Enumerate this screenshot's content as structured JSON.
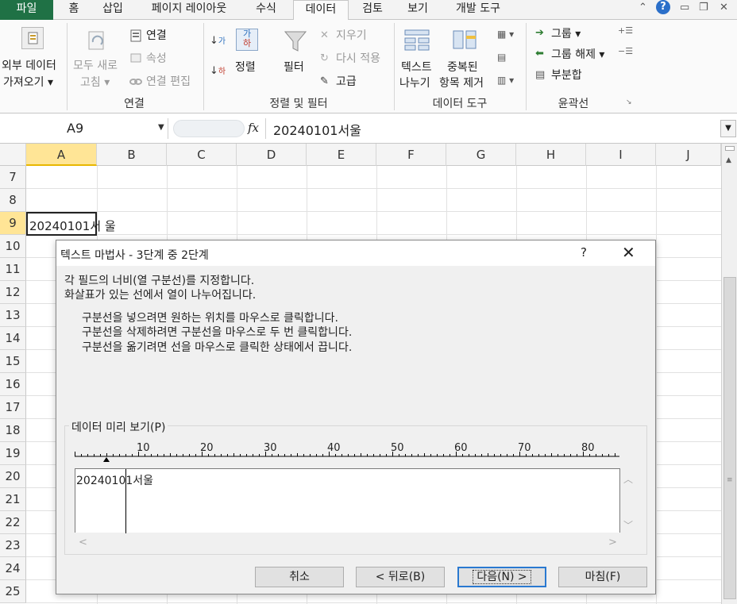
{
  "tabs": [
    {
      "id": "file",
      "label": "파일"
    },
    {
      "id": "home",
      "label": "홈"
    },
    {
      "id": "insert",
      "label": "삽입"
    },
    {
      "id": "page-layout",
      "label": "페이지 레이아웃"
    },
    {
      "id": "formulas",
      "label": "수식"
    },
    {
      "id": "data",
      "label": "데이터"
    },
    {
      "id": "review",
      "label": "검토"
    },
    {
      "id": "view",
      "label": "보기"
    },
    {
      "id": "developer",
      "label": "개발 도구"
    }
  ],
  "window_controls": {
    "minimize_ribbon": "⌃",
    "help": "?",
    "minimize": "▭",
    "restore": "❐",
    "close": "✕"
  },
  "ribbon": {
    "external_data_line1": "외부 데이터",
    "external_data_line2": "가져오기 ▾",
    "refresh_all_line1": "모두 새로",
    "refresh_all_line2": "고침 ▾",
    "connections": "연결",
    "properties": "속성",
    "edit_links": "연결 편집",
    "group_connections": "연결",
    "sort": "정렬",
    "filter": "필터",
    "clear": "지우기",
    "reapply": "다시 적용",
    "advanced": "고급",
    "group_sort_filter": "정렬 및 필터",
    "text_to_columns_line1": "텍스트",
    "text_to_columns_line2": "나누기",
    "remove_dup_line1": "중복된",
    "remove_dup_line2": "항목 제거",
    "group_data_tools": "데이터 도구",
    "group": "그룹 ▾",
    "ungroup": "그룹 해제 ▾",
    "subtotal": "부분합",
    "group_outline": "윤곽선"
  },
  "formula_bar": {
    "name_box": "A9",
    "fx": "fx",
    "value": "20240101서울"
  },
  "columns": [
    "A",
    "B",
    "C",
    "D",
    "E",
    "F",
    "G",
    "H",
    "I",
    "J"
  ],
  "rows": [
    "7",
    "8",
    "9",
    "10",
    "11",
    "12",
    "13",
    "14",
    "15",
    "16",
    "17",
    "18",
    "19",
    "20",
    "21",
    "22",
    "23",
    "24",
    "25"
  ],
  "cell_a9": "20240101서 울",
  "dialog": {
    "title": "텍스트 마법사 - 3단계 중 2단계",
    "help": "?",
    "close": "✕",
    "line1": "각 필드의 너비(열 구분선)를 지정합니다.",
    "line2": "화살표가 있는 선에서 열이 나누어집니다.",
    "hint1": "구분선을 넣으려면 원하는 위치를 마우스로 클릭합니다.",
    "hint2": "구분선을 삭제하려면 구분선을 마우스로 두 번 클릭합니다.",
    "hint3": "구분선을 옮기려면 선을 마우스로 클릭한 상태에서 끕니다.",
    "preview_label": "데이터 미리 보기(P)",
    "ruler_labels": [
      "10",
      "20",
      "30",
      "40",
      "50",
      "60",
      "70",
      "80"
    ],
    "preview_text": "20240101서울",
    "buttons": {
      "cancel": "취소",
      "back": "< 뒤로(B)",
      "next": "다음(N) >",
      "finish": "마침(F)"
    }
  },
  "colors": {
    "file_tab": "#1f7145",
    "selection_header": "#ffe596",
    "default_button_border": "#2a79d0"
  }
}
